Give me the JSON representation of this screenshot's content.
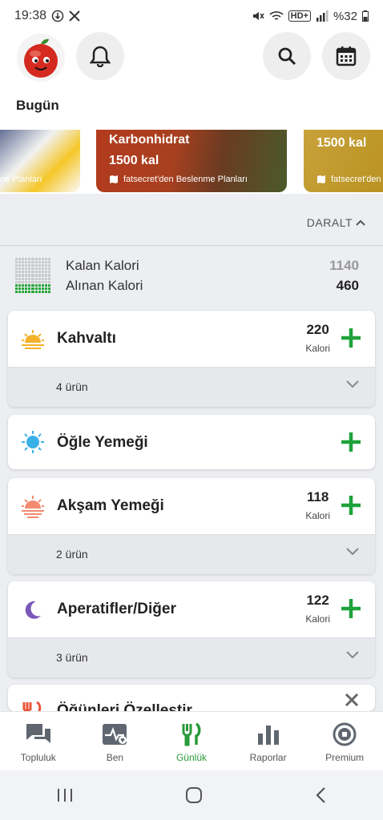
{
  "status_bar": {
    "time": "19:38",
    "battery": "%32",
    "network": "HD+"
  },
  "header": {
    "today": "Bugün"
  },
  "banners": [
    {
      "title": "",
      "kal": "",
      "source": "ne Planları"
    },
    {
      "title": "Karbonhidrat",
      "kal": "1500 kal",
      "source": "fatsecret'den Beslenme Planları"
    },
    {
      "title": "",
      "kal": "1500 kal",
      "source": "fatsecret'den"
    }
  ],
  "collapse_label": "DARALT",
  "calories": {
    "remaining_label": "Kalan Kalori",
    "remaining_value": "1140",
    "consumed_label": "Alınan Kalori",
    "consumed_value": "460"
  },
  "meals": [
    {
      "name": "Kahvaltı",
      "kcal": "220",
      "unit": "Kalori",
      "count": "4 ürün"
    },
    {
      "name": "Öğle Yemeği"
    },
    {
      "name": "Akşam Yemeği",
      "kcal": "118",
      "unit": "Kalori",
      "count": "2 ürün"
    },
    {
      "name": "Aperatifler/Diğer",
      "kcal": "122",
      "unit": "Kalori",
      "count": "3 ürün"
    }
  ],
  "customize": {
    "label": "Öğünleri Özelleştir"
  },
  "nav": [
    {
      "label": "Topluluk",
      "icon": "chat-icon"
    },
    {
      "label": "Ben",
      "icon": "pulse-icon"
    },
    {
      "label": "Günlük",
      "icon": "fork-knife-icon",
      "active": true
    },
    {
      "label": "Raporlar",
      "icon": "bar-chart-icon"
    },
    {
      "label": "Premium",
      "icon": "premium-badge-icon"
    }
  ],
  "colors": {
    "accent_green": "#2a9a3a",
    "plus_green": "#1fa23a"
  }
}
